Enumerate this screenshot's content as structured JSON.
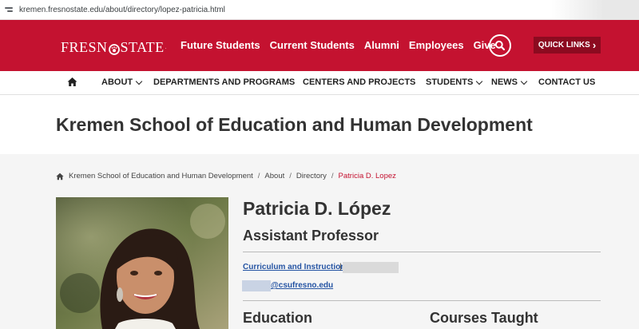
{
  "browser": {
    "url": "kremen.fresnostate.edu/about/directory/lopez-patricia.html"
  },
  "header": {
    "logo_left": "FRESN",
    "logo_right": "STATE",
    "logo_mark": ".",
    "nav": [
      "Future Students",
      "Current Students",
      "Alumni",
      "Employees",
      "Give"
    ],
    "search_icon": "search-icon",
    "quick_links": "QUICK LINKS",
    "quick_links_chevron": "›",
    "accent_color": "#c41230"
  },
  "subnav": {
    "home_icon": "home-icon",
    "items": [
      "ABOUT",
      "DEPARTMENTS AND PROGRAMS",
      "CENTERS AND PROJECTS",
      "STUDENTS",
      "NEWS",
      "CONTACT US"
    ]
  },
  "site_title": "Kremen School of Education and Human Development",
  "breadcrumb": {
    "items": [
      "Kremen School of Education and Human Development",
      "About",
      "Directory"
    ],
    "separator": "/",
    "current": "Patricia D. Lopez"
  },
  "profile": {
    "name": "Patricia D. López",
    "title": "Assistant Professor",
    "department": "Curriculum and Instruction",
    "pipe": "|",
    "email_domain": "@csufresno.edu",
    "sections": [
      "Education",
      "Courses Taught"
    ]
  }
}
